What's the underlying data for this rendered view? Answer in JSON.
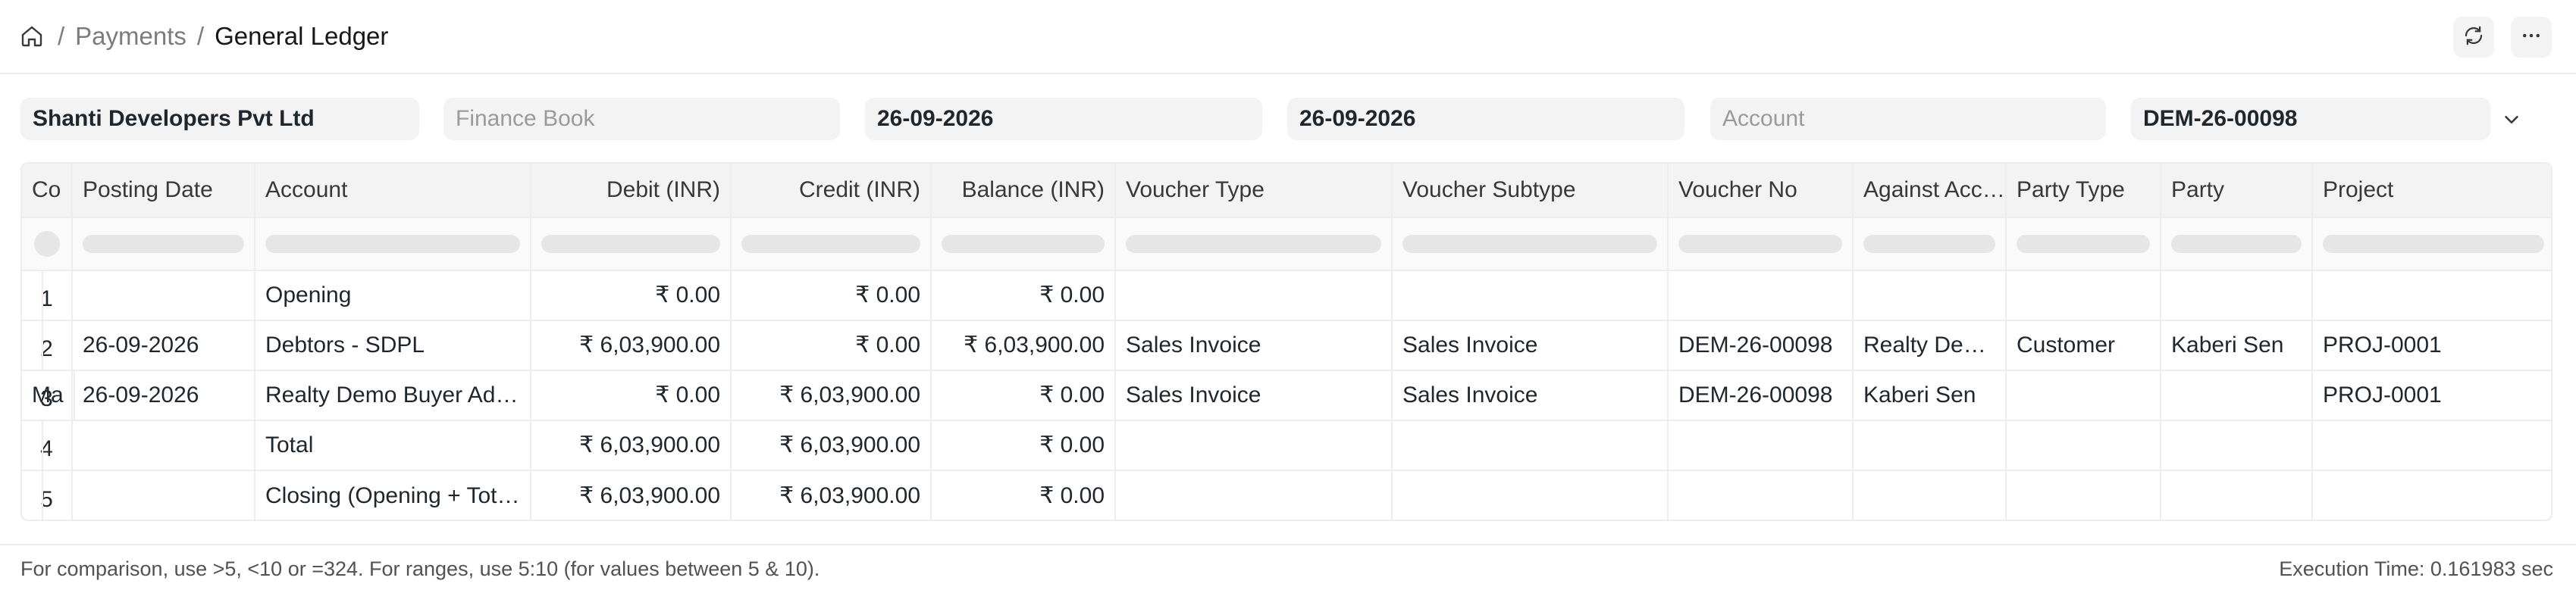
{
  "breadcrumb": {
    "parent": "Payments",
    "current": "General Ledger",
    "separator": "/"
  },
  "icons": {
    "home": "home-icon",
    "refresh": "refresh-icon",
    "more": "more-horizontal-icon",
    "expand": "chevron-down-icon"
  },
  "filters": {
    "company": "Shanti Developers Pvt Ltd",
    "finance_book_placeholder": "Finance Book",
    "from_date": "26-09-2026",
    "to_date": "26-09-2026",
    "account_placeholder": "Account",
    "voucher_no": "DEM-26-00098"
  },
  "table": {
    "columns": [
      "Posting Date",
      "Account",
      "Debit (INR)",
      "Credit (INR)",
      "Balance (INR)",
      "Voucher Type",
      "Voucher Subtype",
      "Voucher No",
      "Against Acc…",
      "Party Type",
      "Party",
      "Project",
      "Co"
    ],
    "rows": [
      {
        "n": "1",
        "cells": [
          "",
          "Opening",
          "₹ 0.00",
          "₹ 0.00",
          "₹ 0.00",
          "",
          "",
          "",
          "",
          "",
          "",
          "",
          ""
        ]
      },
      {
        "n": "2",
        "cells": [
          "26-09-2026",
          "Debtors - SDPL",
          "₹ 6,03,900.00",
          "₹ 0.00",
          "₹ 6,03,900.00",
          "Sales Invoice",
          "Sales Invoice",
          "DEM-26-00098",
          "Realty Demo …",
          "Customer",
          "Kaberi Sen",
          "PROJ-0001",
          ""
        ]
      },
      {
        "n": "3",
        "cells": [
          "26-09-2026",
          "Realty Demo Buyer Ad…",
          "₹ 0.00",
          "₹ 6,03,900.00",
          "₹ 0.00",
          "Sales Invoice",
          "Sales Invoice",
          "DEM-26-00098",
          "Kaberi Sen",
          "",
          "",
          "PROJ-0001",
          "Ma"
        ]
      },
      {
        "n": "4",
        "cells": [
          "",
          "Total",
          "₹ 6,03,900.00",
          "₹ 6,03,900.00",
          "₹ 0.00",
          "",
          "",
          "",
          "",
          "",
          "",
          "",
          ""
        ]
      },
      {
        "n": "5",
        "cells": [
          "",
          "Closing (Opening + Tot…",
          "₹ 6,03,900.00",
          "₹ 6,03,900.00",
          "₹ 0.00",
          "",
          "",
          "",
          "",
          "",
          "",
          "",
          ""
        ]
      }
    ]
  },
  "footer": {
    "hint": "For comparison, use >5, <10 or =324. For ranges, use 5:10 (for values between 5 & 10).",
    "execution_time": "Execution Time: 0.161983 sec"
  }
}
